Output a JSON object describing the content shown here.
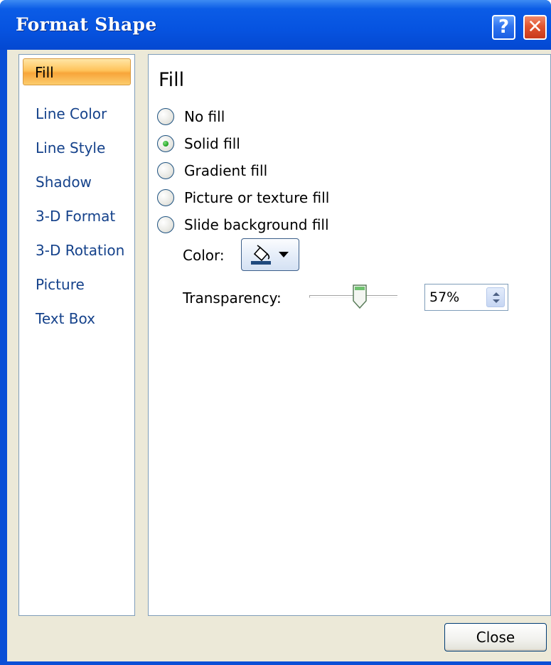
{
  "window": {
    "title": "Format Shape",
    "help_label": "?",
    "close_label": "✕"
  },
  "nav": {
    "items": [
      {
        "label": "Fill",
        "selected": true
      },
      {
        "label": "Line Color",
        "selected": false
      },
      {
        "label": "Line Style",
        "selected": false
      },
      {
        "label": "Shadow",
        "selected": false
      },
      {
        "label": "3-D Format",
        "selected": false
      },
      {
        "label": "3-D Rotation",
        "selected": false
      },
      {
        "label": "Picture",
        "selected": false
      },
      {
        "label": "Text Box",
        "selected": false
      }
    ]
  },
  "fill": {
    "section_title": "Fill",
    "options": [
      {
        "label": "No fill",
        "checked": false
      },
      {
        "label": "Solid fill",
        "checked": true
      },
      {
        "label": "Gradient fill",
        "checked": false
      },
      {
        "label": "Picture or texture fill",
        "checked": false
      },
      {
        "label": "Slide background fill",
        "checked": false
      }
    ],
    "color_label": "Color:",
    "color_icon": "paint-bucket-icon",
    "fill_color": "#1f497d",
    "transparency_label": "Transparency:",
    "transparency_value": "57%",
    "transparency_fraction": 0.57
  },
  "footer": {
    "close_button": "Close"
  }
}
